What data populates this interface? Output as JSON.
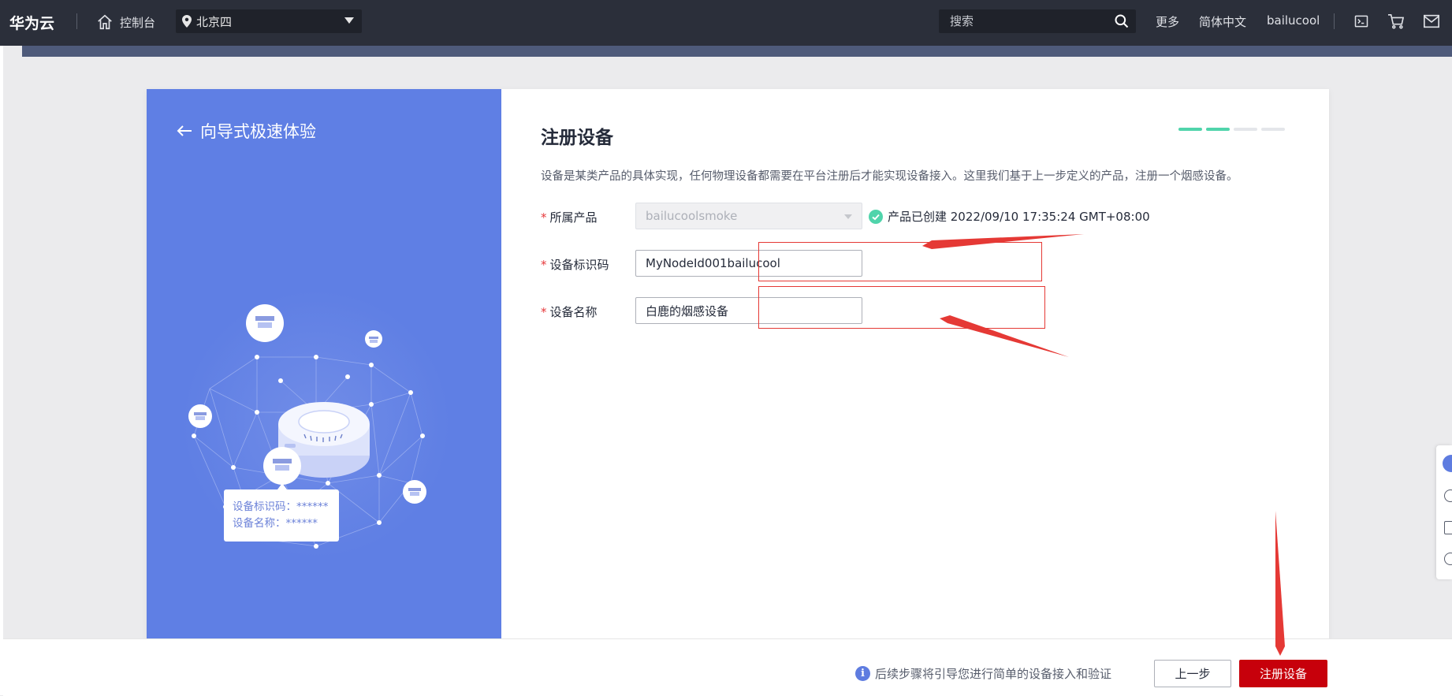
{
  "topbar": {
    "brand": "华为云",
    "console": "控制台",
    "region": "北京四",
    "search_placeholder": "搜索",
    "more": "更多",
    "language": "简体中文",
    "username": "bailucool"
  },
  "left_panel": {
    "back_label": "向导式极速体验",
    "card_line1": "设备标识码：******",
    "card_line2": "设备名称：******"
  },
  "form": {
    "title": "注册设备",
    "description": "设备是某类产品的具体实现，任何物理设备都需要在平台注册后才能实现设备接入。这里我们基于上一步定义的产品，注册一个烟感设备。",
    "step_total": 4,
    "step_current": 2,
    "product": {
      "label": "所属产品",
      "value": "bailucoolsmoke",
      "created_text": "产品已创建 2022/09/10 17:35:24 GMT+08:00"
    },
    "node_id": {
      "label": "设备标识码",
      "value": "MyNodeId001bailucool"
    },
    "device_name": {
      "label": "设备名称",
      "value": "白鹿的烟感设备"
    }
  },
  "footer": {
    "tip": "后续步骤将引导您进行简单的设备接入和验证",
    "prev_label": "上一步",
    "register_label": "注册设备"
  },
  "colors": {
    "topbar": "#2b2f3a",
    "panel_blue": "#5f7fe4",
    "step_active": "#50d4ab",
    "primary_red": "#c7000b",
    "annotation_red": "#e53935"
  }
}
